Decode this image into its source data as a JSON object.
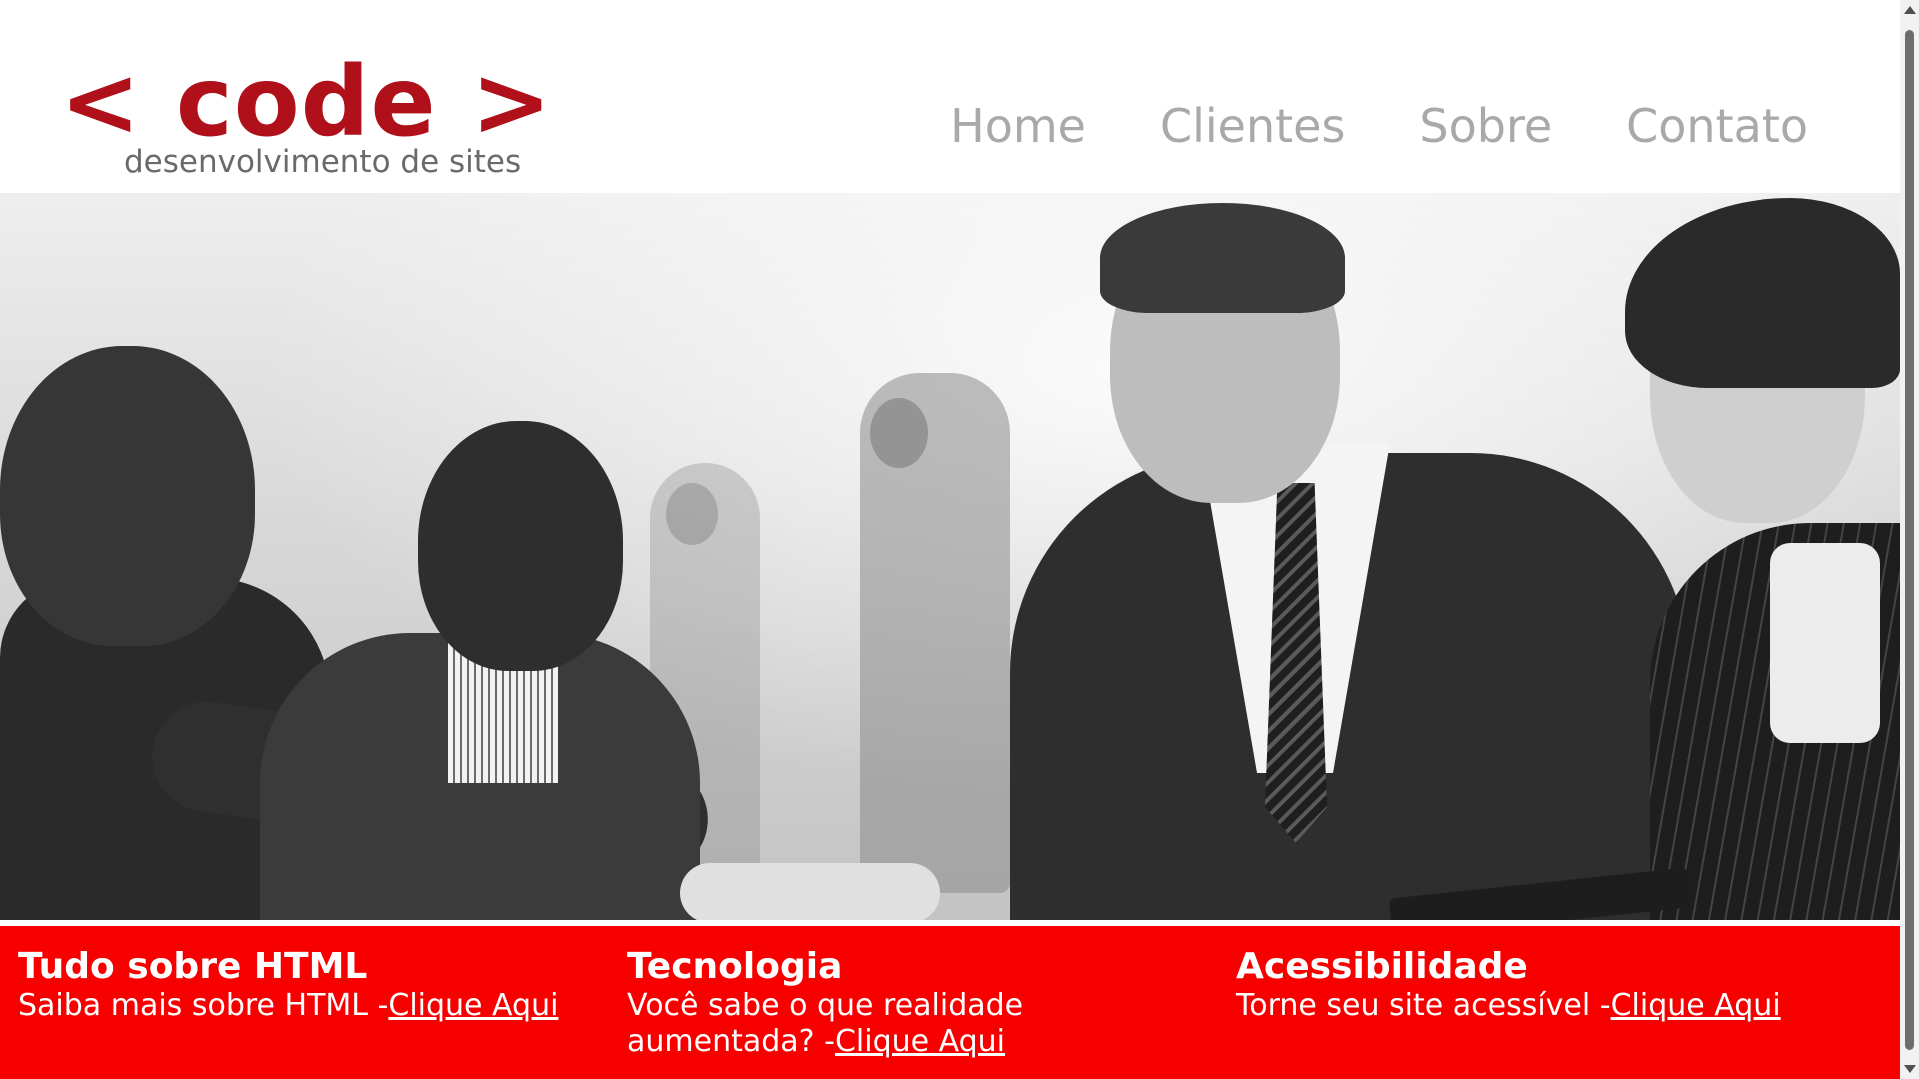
{
  "logo": {
    "main": "< code >",
    "tagline": "desenvolvimento de sites",
    "color": "#b0101a"
  },
  "nav": {
    "items": [
      {
        "label": "Home"
      },
      {
        "label": "Clientes"
      },
      {
        "label": "Sobre"
      },
      {
        "label": "Contato"
      }
    ]
  },
  "features": [
    {
      "title": "Tudo sobre HTML",
      "text": "Saiba mais sobre HTML -",
      "link": "Clique Aqui"
    },
    {
      "title": "Tecnologia",
      "text": "Você sabe o que realidade aumentada? -",
      "link": "Clique Aqui"
    },
    {
      "title": "Acessibilidade",
      "text": "Torne seu site acessível -",
      "link": "Clique Aqui"
    }
  ],
  "colors": {
    "band": "#f60000",
    "nav_text": "#a9a9a9"
  }
}
